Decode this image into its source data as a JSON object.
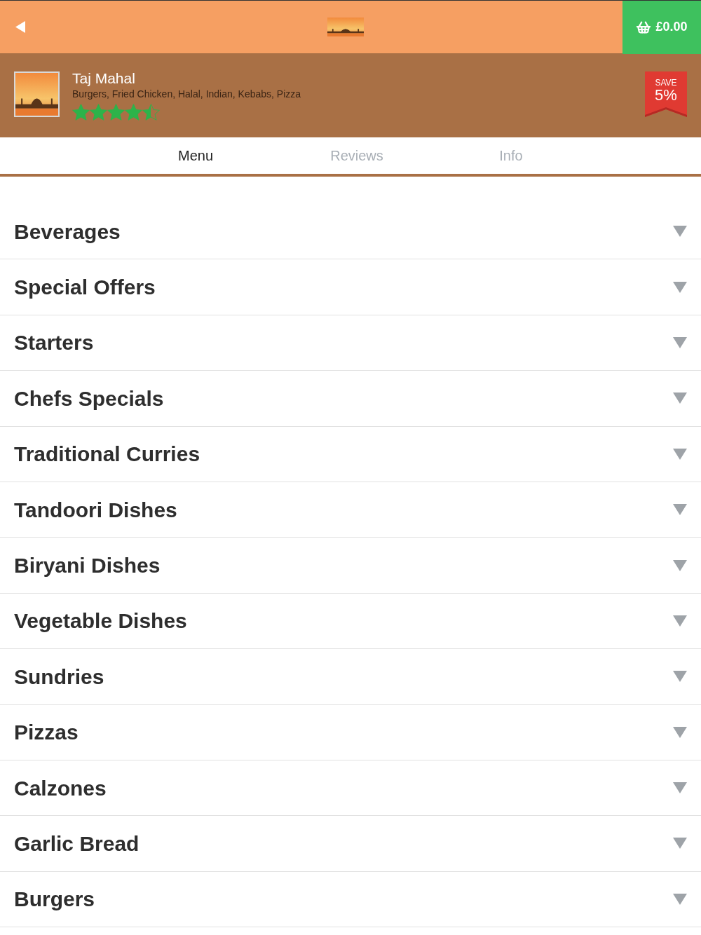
{
  "top_bar": {
    "cart_total": "£0.00"
  },
  "restaurant": {
    "name": "Taj Mahal",
    "cuisines": "Burgers, Fried Chicken, Halal, Indian, Kebabs, Pizza",
    "stars": 4.5,
    "badge": {
      "label": "SAVE",
      "value": "5%"
    }
  },
  "tabs": [
    {
      "label": "Menu",
      "selected": true
    },
    {
      "label": "Reviews",
      "selected": false
    },
    {
      "label": "Info",
      "selected": false
    }
  ],
  "categories": [
    {
      "name": "Beverages",
      "expanded": false
    },
    {
      "name": "Special Offers",
      "expanded": false
    },
    {
      "name": "Starters",
      "expanded": false
    },
    {
      "name": "Chefs Specials",
      "expanded": false
    },
    {
      "name": "Traditional Curries",
      "expanded": false
    },
    {
      "name": "Tandoori Dishes",
      "expanded": false
    },
    {
      "name": "Biryani Dishes",
      "expanded": false
    },
    {
      "name": "Vegetable Dishes",
      "expanded": false
    },
    {
      "name": "Sundries",
      "expanded": false
    },
    {
      "name": "Pizzas",
      "expanded": false
    },
    {
      "name": "Calzones",
      "expanded": false
    },
    {
      "name": "Garlic Bread",
      "expanded": false
    },
    {
      "name": "Burgers",
      "expanded": false
    }
  ]
}
